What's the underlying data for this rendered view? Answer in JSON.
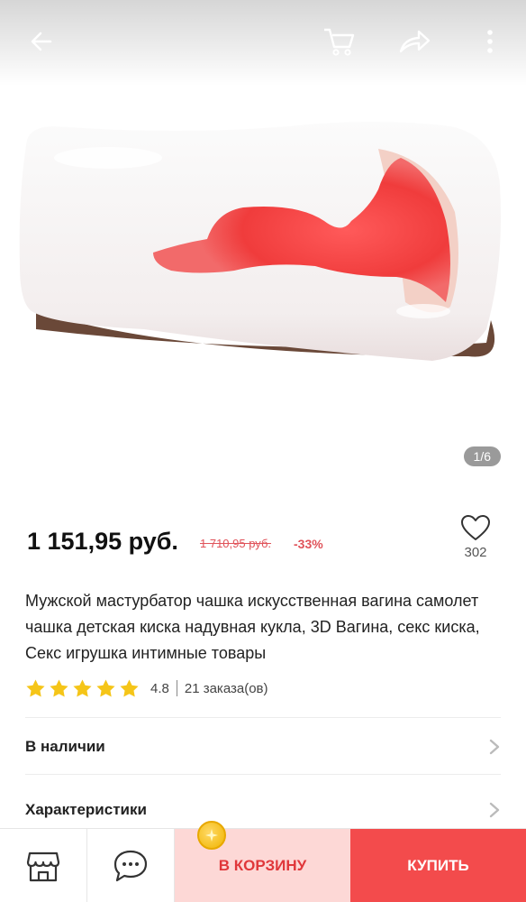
{
  "gallery": {
    "counter": "1/6"
  },
  "icons": {
    "back": "arrow-left-icon",
    "cart": "cart-icon",
    "share": "share-icon",
    "more": "more-vertical-icon",
    "favorite": "heart-icon",
    "store": "store-icon",
    "chat": "chat-icon",
    "coin": "coin-icon"
  },
  "product": {
    "price": "1 151,95 руб.",
    "old_price": "1 710,95 руб.",
    "discount": "-33%",
    "favorites_count": "302",
    "title": "Мужской мастурбатор чашка искусственная вагина самолет чашка детская киска надувная кукла, 3D Вагина, секс киска, Секс игрушка интимные товары",
    "rating": 4.8,
    "rating_text": "4.8",
    "stars": 5,
    "orders": "21 заказа(ов)"
  },
  "rows": {
    "availability": "В наличии",
    "characteristics": "Характеристики"
  },
  "bottom": {
    "add_to_cart": "В КОРЗИНУ",
    "buy": "КУПИТЬ"
  },
  "colors": {
    "accent": "#f34b4c",
    "accent_light": "#fdd8d6",
    "price_red": "#e0535a",
    "star": "#f5c518"
  }
}
